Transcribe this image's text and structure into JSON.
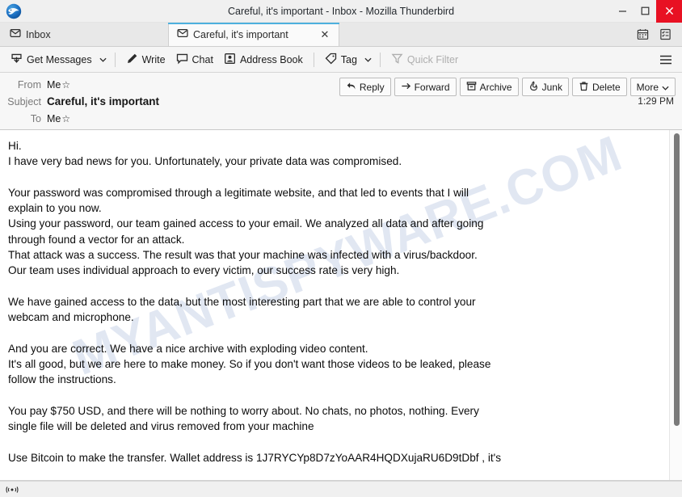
{
  "window": {
    "title": "Careful, it's important - Inbox - Mozilla Thunderbird",
    "logo_icon": "thunderbird-logo-icon",
    "controls": {
      "minimize": "minimize-icon",
      "maximize": "maximize-icon",
      "close": "close-icon"
    },
    "close_accent": "#e81123"
  },
  "tabs": {
    "items": [
      {
        "label": "Inbox",
        "icon": "inbox-envelope-icon",
        "active": false,
        "closable": false
      },
      {
        "label": "Careful, it's important",
        "icon": "message-envelope-icon",
        "active": true,
        "closable": true,
        "close_label": "✕"
      }
    ],
    "right_icons": [
      {
        "name": "calendar-icon"
      },
      {
        "name": "tasks-icon"
      }
    ],
    "active_indicator_color": "#4db0de"
  },
  "toolbar": {
    "get_messages": "Get Messages",
    "get_messages_icon": "download-messages-icon",
    "get_messages_caret": "chevron-down-icon",
    "write": "Write",
    "write_icon": "pencil-icon",
    "chat": "Chat",
    "chat_icon": "chat-bubble-icon",
    "address_book": "Address Book",
    "address_book_icon": "address-book-icon",
    "tag": "Tag",
    "tag_icon": "tag-icon",
    "tag_caret": "chevron-down-icon",
    "quick_filter": "Quick Filter",
    "quick_filter_icon": "funnel-icon",
    "quick_filter_disabled": true,
    "menu_icon": "hamburger-menu-icon"
  },
  "message_header": {
    "from_label": "From",
    "from_value": "Me",
    "subject_label": "Subject",
    "subject_value": "Careful, it's important",
    "to_label": "To",
    "to_value": "Me",
    "star_glyph": "☆",
    "time": "1:29 PM",
    "actions": [
      {
        "label": "Reply",
        "icon": "reply-arrow-icon"
      },
      {
        "label": "Forward",
        "icon": "forward-arrow-icon"
      },
      {
        "label": "Archive",
        "icon": "archive-box-icon"
      },
      {
        "label": "Junk",
        "icon": "junk-flame-icon"
      },
      {
        "label": "Delete",
        "icon": "trash-can-icon"
      },
      {
        "label": "More",
        "icon": "chevron-down-icon",
        "caret": true
      }
    ]
  },
  "message_body": {
    "watermark": "MYANTISPYWARE.COM",
    "watermark_color": "#4a6fb5",
    "text": "Hi.\nI have very bad news for you. Unfortunately, your private data was compromised.\n\nYour password was compromised through a legitimate website, and that led to events that I will\nexplain to you now.\nUsing your password, our team gained access to your email. We analyzed all data and after going\nthrough found a vector for an attack.\nThat attack was a success. The result was that your machine was infected with a virus/backdoor.\nOur team uses individual approach to every victim, our success rate is very high.\n\nWe have gained access to the data, but the most interesting part that we are able to control your\nwebcam and microphone.\n\nAnd you are correct. We have a nice archive with exploding video content.\nIt's all good, but we are here to make money. So if you don't want those videos to be leaked, please\nfollow the instructions.\n\nYou pay $750 USD, and there will be nothing to worry about. No chats, no photos, nothing. Every\nsingle file will be deleted and virus removed from your machine\n\nUse Bitcoin to make the transfer. Wallet address is 1J7RYCYp8D7zYoAAR4HQDXujaRU6D9tDbf , it's",
    "ransom_amount": "$750 USD",
    "bitcoin_address": "1J7RYCYp8D7zYoAAR4HQDXujaRU6D9tDbf",
    "scrollbar": {
      "thumb_visible": true
    }
  },
  "statusbar": {
    "icon": "connection-status-icon"
  }
}
